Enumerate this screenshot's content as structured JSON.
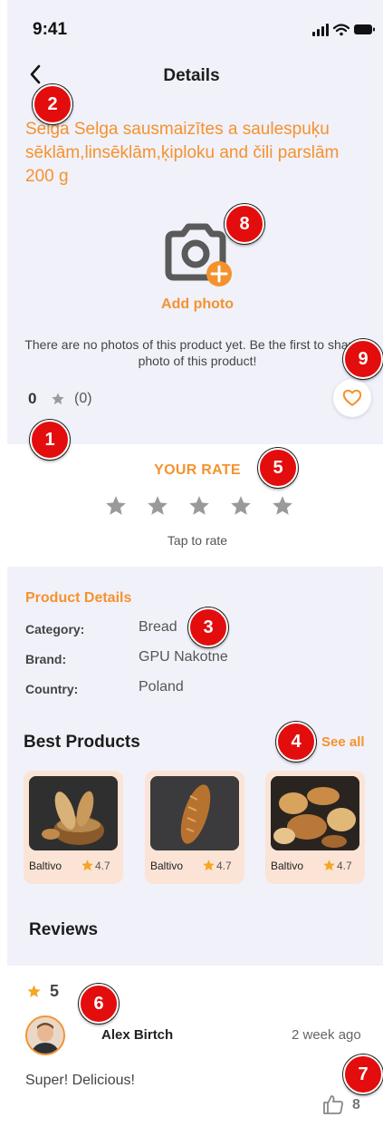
{
  "status_bar": {
    "time": "9:41"
  },
  "header": {
    "title": "Details",
    "back_icon": "chevron-left-icon"
  },
  "product": {
    "title": "Selga Selga sausmaizītes a saulespuķu sēklām,linsēklām,ķiploku and čili parslām 200 g",
    "add_photo_label": "Add photo",
    "no_photos_text": "There are no photos of this product yet. Be the first to share a photo of this product!",
    "rating_value": "0",
    "rating_count": "(0)"
  },
  "your_rate": {
    "heading": "YOUR RATE",
    "star_count": 5,
    "hint": "Tap to rate"
  },
  "product_details": {
    "heading": "Product Details",
    "rows": [
      {
        "label": "Category:",
        "value": "Bread"
      },
      {
        "label": "Brand:",
        "value": "GPU Nakotne"
      },
      {
        "label": "Country:",
        "value": "Poland"
      }
    ]
  },
  "best_products": {
    "heading": "Best Products",
    "see_all_label": "See all",
    "items": [
      {
        "brand": "Baltivo",
        "rating": "4.7",
        "image": "bread-basket-photo"
      },
      {
        "brand": "Baltivo",
        "rating": "4.7",
        "image": "baguette-photo"
      },
      {
        "brand": "Baltivo",
        "rating": "4.7",
        "image": "bread-assortment-photo"
      }
    ]
  },
  "reviews": {
    "heading": "Reviews",
    "items": [
      {
        "score": "5",
        "reviewer": "Alex Birtch",
        "date": "2 week ago",
        "text": "Super! Delicious!",
        "likes": "8"
      }
    ]
  },
  "markers": [
    "1",
    "2",
    "3",
    "4",
    "5",
    "6",
    "7",
    "8",
    "9"
  ],
  "colors": {
    "accent": "#f5922e",
    "star_inactive": "#9a9a9a",
    "star_active": "#f5a623",
    "section_background": "#f1f1fa",
    "marker": "#e30d0d"
  }
}
